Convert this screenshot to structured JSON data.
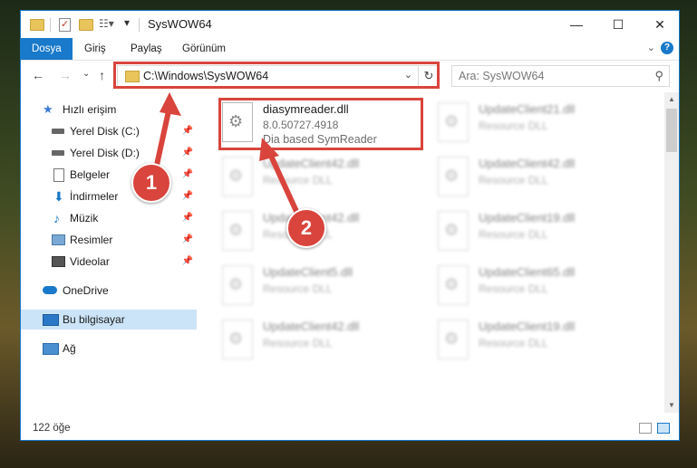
{
  "window": {
    "title": "SysWOW64",
    "controls": {
      "minimize": "—",
      "maximize": "☐",
      "close": "✕"
    }
  },
  "ribbon": {
    "tabs": [
      {
        "label": "Dosya",
        "active": true
      },
      {
        "label": "Giriş",
        "active": false
      },
      {
        "label": "Paylaş",
        "active": false
      },
      {
        "label": "Görünüm",
        "active": false
      }
    ],
    "expand": "⌄",
    "help": "?"
  },
  "nav": {
    "back": "←",
    "forward": "→",
    "recent": "⌄",
    "up": "↑",
    "address": "C:\\Windows\\SysWOW64",
    "address_dropdown": "⌄",
    "refresh": "↻",
    "search_placeholder": "Ara: SysWOW64",
    "search_icon": "⚲"
  },
  "sidebar": {
    "items": [
      {
        "label": "Hızlı erişim",
        "icon": "star-icon",
        "pinned": false
      },
      {
        "label": "Yerel Disk (C:)",
        "icon": "drive-icon",
        "pinned": true
      },
      {
        "label": "Yerel Disk (D:)",
        "icon": "drive-icon",
        "pinned": true
      },
      {
        "label": "Belgeler",
        "icon": "document-icon",
        "pinned": true
      },
      {
        "label": "İndirmeler",
        "icon": "download-icon",
        "pinned": true
      },
      {
        "label": "Müzik",
        "icon": "music-icon",
        "pinned": true
      },
      {
        "label": "Resimler",
        "icon": "pictures-icon",
        "pinned": true
      },
      {
        "label": "Videolar",
        "icon": "video-icon",
        "pinned": true
      },
      {
        "label": "OneDrive",
        "icon": "cloud-icon",
        "pinned": false
      },
      {
        "label": "Bu bilgisayar",
        "icon": "computer-icon",
        "pinned": false,
        "selected": true
      },
      {
        "label": "Ağ",
        "icon": "network-icon",
        "pinned": false
      }
    ],
    "pin_glyph": "📌"
  },
  "files": {
    "highlighted": {
      "name": "diasymreader.dll",
      "version": "8.0.50727.4918",
      "description": "Dia based SymReader"
    },
    "items": [
      {
        "name": "UpdateClient21.dll",
        "description": "Resource DLL"
      },
      {
        "name": "UpdateClient42.dll",
        "description": "Resource DLL"
      },
      {
        "name": "UpdateClient42.dll",
        "description": "Resource DLL"
      },
      {
        "name": "UpdateClient42.dll",
        "description": "Resource DLL"
      },
      {
        "name": "UpdateClient19.dll",
        "description": "Resource DLL"
      },
      {
        "name": "UpdateClient5.dll",
        "description": "Resource DLL"
      },
      {
        "name": "UpdateClient65.dll",
        "description": "Resource DLL"
      },
      {
        "name": "UpdateClient42.dll",
        "description": "Resource DLL"
      },
      {
        "name": "UpdateClient19.dll",
        "description": "Resource DLL"
      }
    ]
  },
  "status": {
    "count": "122 öğe"
  },
  "annotations": {
    "step1": "1",
    "step2": "2",
    "color": "#d9443c"
  }
}
